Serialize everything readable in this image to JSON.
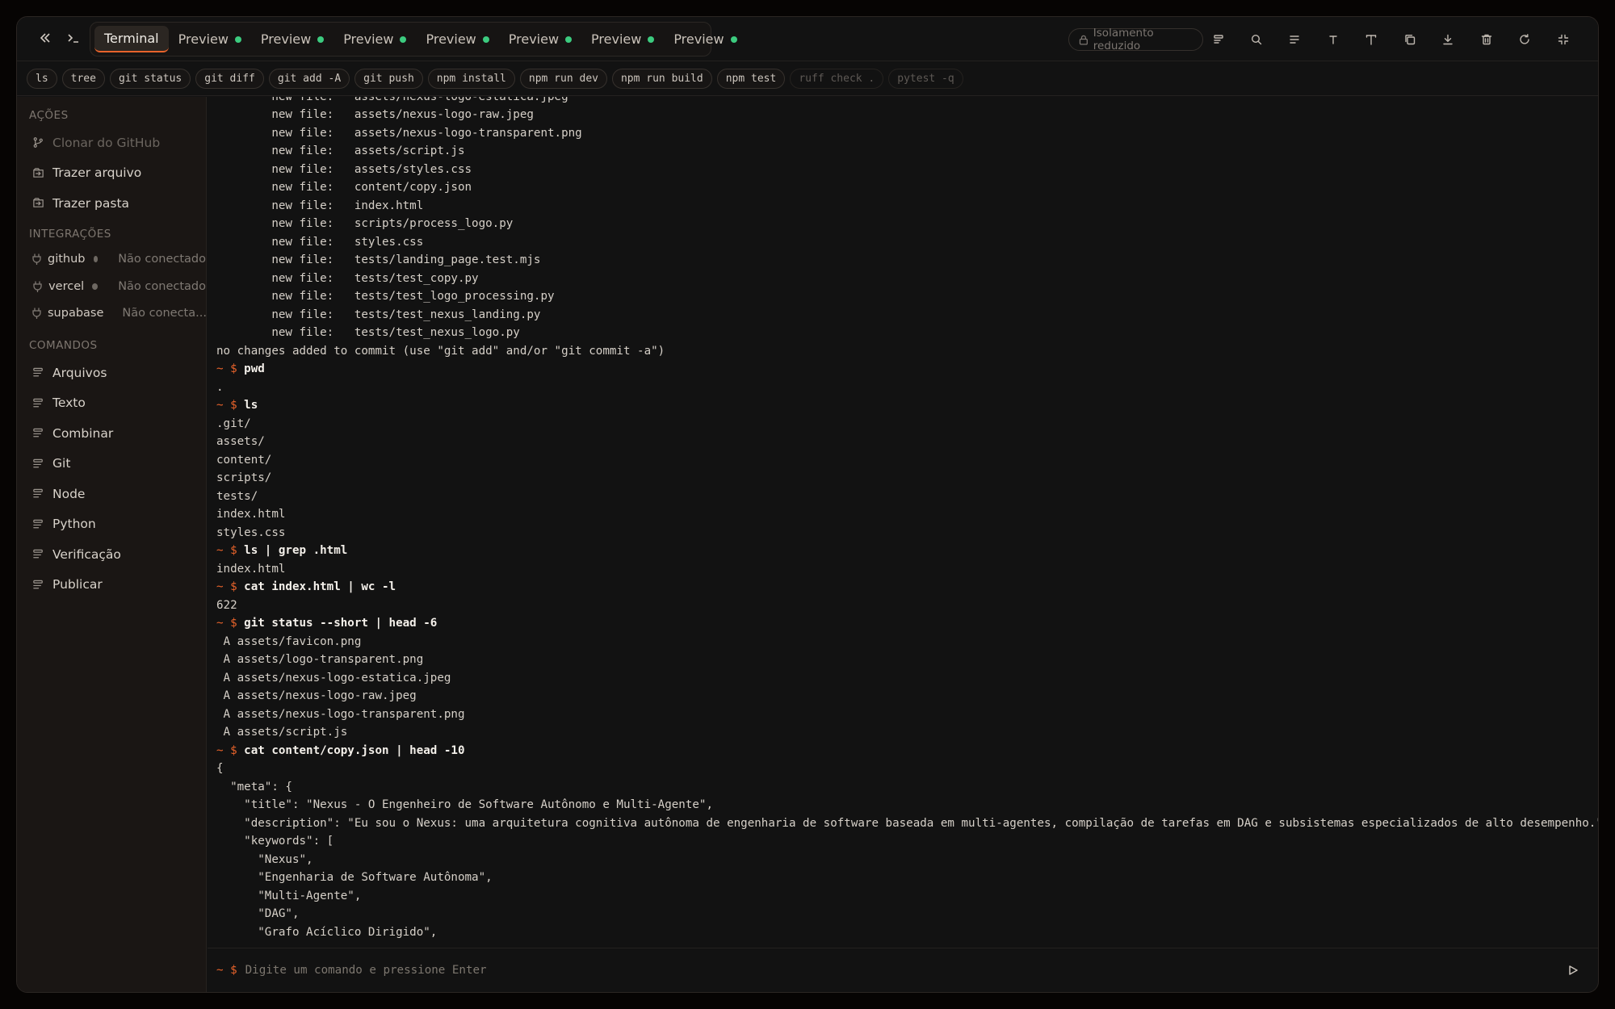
{
  "topbar": {
    "tabs": [
      {
        "label": "Terminal",
        "active": true,
        "dot": false
      },
      {
        "label": "Preview",
        "active": false,
        "dot": true
      },
      {
        "label": "Preview",
        "active": false,
        "dot": true
      },
      {
        "label": "Preview",
        "active": false,
        "dot": true
      },
      {
        "label": "Preview",
        "active": false,
        "dot": true
      },
      {
        "label": "Preview",
        "active": false,
        "dot": true
      },
      {
        "label": "Preview",
        "active": false,
        "dot": true
      },
      {
        "label": "Preview",
        "active": false,
        "dot": true
      }
    ],
    "isolation_label": "Isolamento reduzido",
    "tool_icons": [
      "commands-icon",
      "search-icon",
      "wrap-icon",
      "font-small-icon",
      "font-large-icon",
      "copy-icon",
      "download-icon",
      "trash-icon",
      "refresh-icon",
      "collapse-icon"
    ]
  },
  "chips": [
    {
      "label": "ls",
      "enabled": true
    },
    {
      "label": "tree",
      "enabled": true
    },
    {
      "label": "git status",
      "enabled": true
    },
    {
      "label": "git diff",
      "enabled": true
    },
    {
      "label": "git add -A",
      "enabled": true
    },
    {
      "label": "git push",
      "enabled": true
    },
    {
      "label": "npm install",
      "enabled": true
    },
    {
      "label": "npm run dev",
      "enabled": true
    },
    {
      "label": "npm run build",
      "enabled": true
    },
    {
      "label": "npm test",
      "enabled": true
    },
    {
      "label": "ruff check .",
      "enabled": false
    },
    {
      "label": "pytest -q",
      "enabled": false
    }
  ],
  "sidebar": {
    "actions_title": "AÇÕES",
    "actions": [
      {
        "label": "Clonar do GitHub",
        "icon": "git-branch-icon",
        "disabled": true
      },
      {
        "label": "Trazer arquivo",
        "icon": "import-file-icon",
        "disabled": false
      },
      {
        "label": "Trazer pasta",
        "icon": "import-folder-icon",
        "disabled": false
      }
    ],
    "integrations_title": "INTEGRAÇÕES",
    "integrations": [
      {
        "name": "github",
        "status": "Não conectado"
      },
      {
        "name": "vercel",
        "status": "Não conectado"
      },
      {
        "name": "supabase",
        "status": "Não conecta..."
      }
    ],
    "commands_title": "COMANDOS",
    "commands": [
      "Arquivos",
      "Texto",
      "Combinar",
      "Git",
      "Node",
      "Python",
      "Verificação",
      "Publicar"
    ]
  },
  "terminal": {
    "prompt": "~ $",
    "lines": [
      {
        "type": "out",
        "text": "        new file:   assets/nexus-logo-estatica.jpeg"
      },
      {
        "type": "out",
        "text": "        new file:   assets/nexus-logo-raw.jpeg"
      },
      {
        "type": "out",
        "text": "        new file:   assets/nexus-logo-transparent.png"
      },
      {
        "type": "out",
        "text": "        new file:   assets/script.js"
      },
      {
        "type": "out",
        "text": "        new file:   assets/styles.css"
      },
      {
        "type": "out",
        "text": "        new file:   content/copy.json"
      },
      {
        "type": "out",
        "text": "        new file:   index.html"
      },
      {
        "type": "out",
        "text": "        new file:   scripts/process_logo.py"
      },
      {
        "type": "out",
        "text": "        new file:   styles.css"
      },
      {
        "type": "out",
        "text": "        new file:   tests/landing_page.test.mjs"
      },
      {
        "type": "out",
        "text": "        new file:   tests/test_copy.py"
      },
      {
        "type": "out",
        "text": "        new file:   tests/test_logo_processing.py"
      },
      {
        "type": "out",
        "text": "        new file:   tests/test_nexus_landing.py"
      },
      {
        "type": "out",
        "text": "        new file:   tests/test_nexus_logo.py"
      },
      {
        "type": "out",
        "text": "no changes added to commit (use \"git add\" and/or \"git commit -a\")"
      },
      {
        "type": "cmd",
        "text": "pwd"
      },
      {
        "type": "out",
        "text": "."
      },
      {
        "type": "cmd",
        "text": "ls"
      },
      {
        "type": "out",
        "text": ".git/"
      },
      {
        "type": "out",
        "text": "assets/"
      },
      {
        "type": "out",
        "text": "content/"
      },
      {
        "type": "out",
        "text": "scripts/"
      },
      {
        "type": "out",
        "text": "tests/"
      },
      {
        "type": "out",
        "text": "index.html"
      },
      {
        "type": "out",
        "text": "styles.css"
      },
      {
        "type": "cmd",
        "text": "ls | grep .html"
      },
      {
        "type": "out",
        "text": "index.html"
      },
      {
        "type": "cmd",
        "text": "cat index.html | wc -l"
      },
      {
        "type": "out",
        "text": "622"
      },
      {
        "type": "cmd",
        "text": "git status --short | head -6"
      },
      {
        "type": "out",
        "text": " A assets/favicon.png"
      },
      {
        "type": "out",
        "text": " A assets/logo-transparent.png"
      },
      {
        "type": "out",
        "text": " A assets/nexus-logo-estatica.jpeg"
      },
      {
        "type": "out",
        "text": " A assets/nexus-logo-raw.jpeg"
      },
      {
        "type": "out",
        "text": " A assets/nexus-logo-transparent.png"
      },
      {
        "type": "out",
        "text": " A assets/script.js"
      },
      {
        "type": "cmd",
        "text": "cat content/copy.json | head -10"
      },
      {
        "type": "out",
        "text": "{"
      },
      {
        "type": "out",
        "text": "  \"meta\": {"
      },
      {
        "type": "out",
        "text": "    \"title\": \"Nexus - O Engenheiro de Software Autônomo e Multi-Agente\","
      },
      {
        "type": "out",
        "text": "    \"description\": \"Eu sou o Nexus: uma arquitetura cognitiva autônoma de engenharia de software baseada em multi-agentes, compilação de tarefas em DAG e subsistemas especializados de alto desempenho.\","
      },
      {
        "type": "out",
        "text": "    \"keywords\": ["
      },
      {
        "type": "out",
        "text": "      \"Nexus\","
      },
      {
        "type": "out",
        "text": "      \"Engenharia de Software Autônoma\","
      },
      {
        "type": "out",
        "text": "      \"Multi-Agente\","
      },
      {
        "type": "out",
        "text": "      \"DAG\","
      },
      {
        "type": "out",
        "text": "      \"Grafo Acíclico Dirigido\","
      }
    ]
  },
  "input": {
    "prompt": "~ $",
    "placeholder": "Digite um comando e pressione Enter"
  },
  "colors": {
    "accent": "#e8632b",
    "status_dot": "#3ccb7f"
  }
}
